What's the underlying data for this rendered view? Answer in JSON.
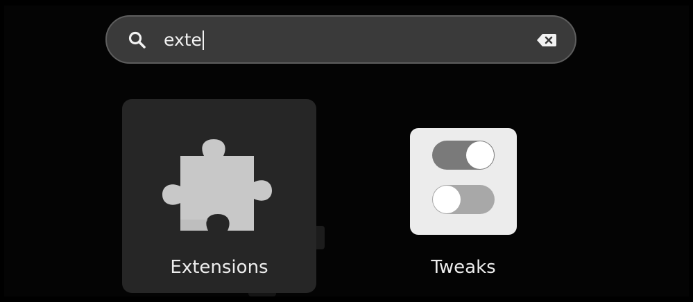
{
  "search": {
    "query": "exte",
    "search_icon": "search-icon",
    "clear_icon": "backspace-clear-icon"
  },
  "results": [
    {
      "label": "Extensions",
      "icon": "puzzle-piece-icon",
      "selected": true
    },
    {
      "label": "Tweaks",
      "icon": "toggle-switches-icon",
      "selected": false
    }
  ],
  "colors": {
    "background": "#000000",
    "search_bg": "#3a3a3a",
    "search_border": "#5e5e5e",
    "tile_selected": "#262626",
    "text": "#eeeeee"
  }
}
